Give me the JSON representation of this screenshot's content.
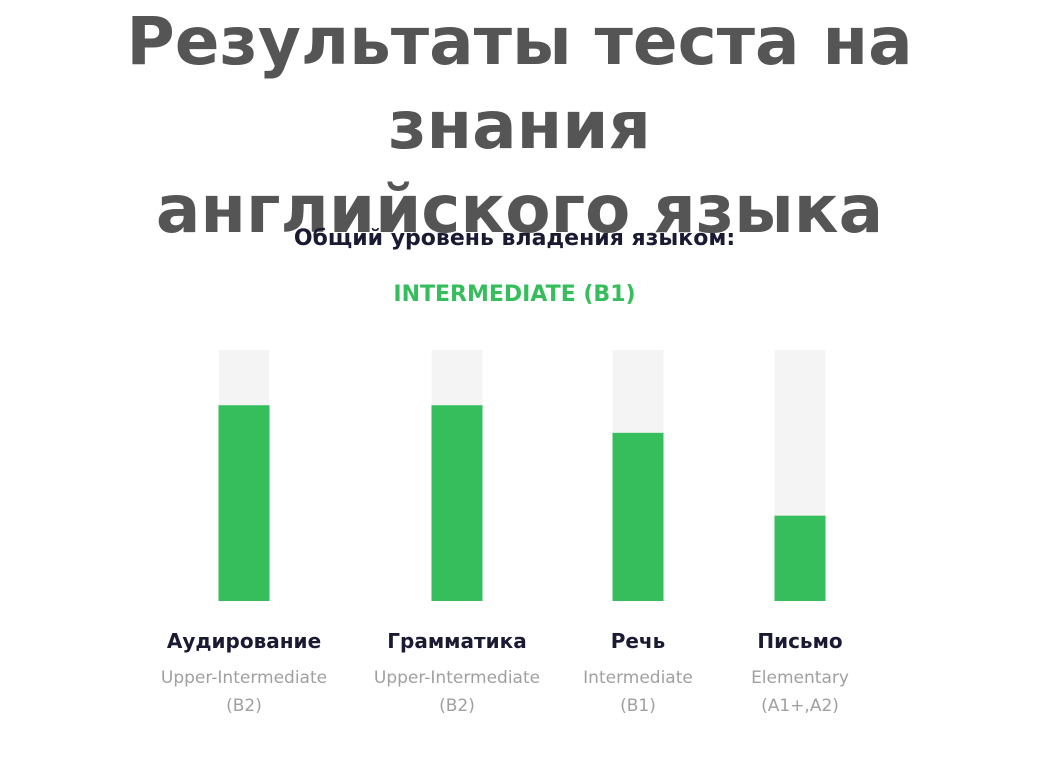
{
  "header": {
    "title_line1": "Результаты теста на знания",
    "title_line2": "английского языка",
    "subtitle": "Общий уровень владения языком:",
    "overall_level": "INTERMEDIATE (B1)"
  },
  "colors": {
    "title": "#555555",
    "subtitle": "#1a1a33",
    "accent": "#37be5c",
    "track": "#f4f4f4",
    "label_primary": "#1a1a33",
    "label_secondary": "#a0a0a0"
  },
  "chart_data": {
    "type": "bar",
    "categories": [
      "Аудирование",
      "Грамматика",
      "Речь",
      "Письмо"
    ],
    "sublabels": [
      [
        "Upper-Intermediate",
        "(B2)"
      ],
      [
        "Upper-Intermediate",
        "(B2)"
      ],
      [
        "Intermediate",
        "(B1)"
      ],
      [
        "Elementary",
        "(A1+,A2)"
      ]
    ],
    "values": [
      78,
      78,
      67,
      34
    ],
    "ylim": [
      0,
      100
    ],
    "title": "",
    "xlabel": "",
    "ylabel": "",
    "grid": false,
    "legend": "none"
  }
}
